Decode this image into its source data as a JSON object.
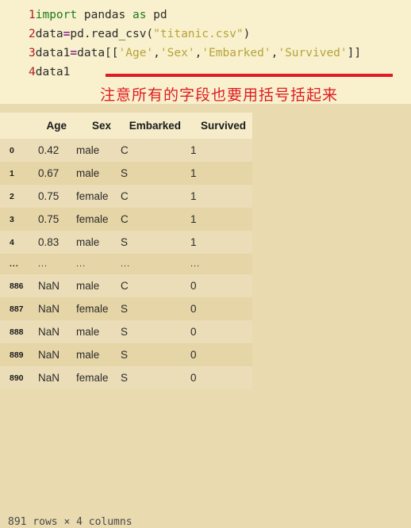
{
  "code_cell": {
    "lines": [
      {
        "number": "1",
        "tokens": [
          {
            "text": "import",
            "style": "kw"
          },
          {
            "text": " pandas ",
            "style": "plain"
          },
          {
            "text": "as",
            "style": "kw"
          },
          {
            "text": " pd",
            "style": "plain"
          }
        ]
      },
      {
        "number": "2",
        "tokens": [
          {
            "text": "data",
            "style": "plain"
          },
          {
            "text": "=",
            "style": "op"
          },
          {
            "text": "pd.read_csv(",
            "style": "plain"
          },
          {
            "text": "\"titanic.csv\"",
            "style": "str"
          },
          {
            "text": ")",
            "style": "plain"
          }
        ]
      },
      {
        "number": "3",
        "tokens": [
          {
            "text": "data1",
            "style": "plain"
          },
          {
            "text": "=",
            "style": "op"
          },
          {
            "text": "data[[",
            "style": "plain"
          },
          {
            "text": "'Age'",
            "style": "str"
          },
          {
            "text": ",",
            "style": "plain"
          },
          {
            "text": "'Sex'",
            "style": "str"
          },
          {
            "text": ",",
            "style": "plain"
          },
          {
            "text": "'Embarked'",
            "style": "str"
          },
          {
            "text": ",",
            "style": "plain"
          },
          {
            "text": "'Survived'",
            "style": "str"
          },
          {
            "text": "]]",
            "style": "plain"
          }
        ]
      },
      {
        "number": "4",
        "tokens": [
          {
            "text": "data1",
            "style": "plain"
          }
        ]
      }
    ]
  },
  "annotation": {
    "text": "注意所有的字段也要用括号括起来",
    "color": "#e01b22"
  },
  "table": {
    "index_header": "",
    "columns": [
      "Age",
      "Sex",
      "Embarked",
      "Survived"
    ],
    "rows": [
      {
        "index": "0",
        "cells": [
          "0.42",
          "male",
          "C",
          "1"
        ]
      },
      {
        "index": "1",
        "cells": [
          "0.67",
          "male",
          "S",
          "1"
        ]
      },
      {
        "index": "2",
        "cells": [
          "0.75",
          "female",
          "C",
          "1"
        ]
      },
      {
        "index": "3",
        "cells": [
          "0.75",
          "female",
          "C",
          "1"
        ]
      },
      {
        "index": "4",
        "cells": [
          "0.83",
          "male",
          "S",
          "1"
        ]
      },
      {
        "index": "...",
        "cells": [
          "...",
          "...",
          "...",
          "..."
        ]
      },
      {
        "index": "886",
        "cells": [
          "NaN",
          "male",
          "C",
          "0"
        ]
      },
      {
        "index": "887",
        "cells": [
          "NaN",
          "female",
          "S",
          "0"
        ]
      },
      {
        "index": "888",
        "cells": [
          "NaN",
          "male",
          "S",
          "0"
        ]
      },
      {
        "index": "889",
        "cells": [
          "NaN",
          "male",
          "S",
          "0"
        ]
      },
      {
        "index": "890",
        "cells": [
          "NaN",
          "female",
          "S",
          "0"
        ]
      }
    ],
    "footer": "891 rows × 4 columns"
  },
  "colors": {
    "code_background": "#f9f1cd",
    "output_background": "#e9daaf",
    "header_row": "#f6ecc9",
    "row_odd": "#e6d5a6",
    "row_even": "#ebddb7",
    "keyword": "#1f7a1f",
    "string": "#b5a33c",
    "operator": "#8a2f8a",
    "line_number": "#b02020",
    "annotation": "#e01b22"
  }
}
